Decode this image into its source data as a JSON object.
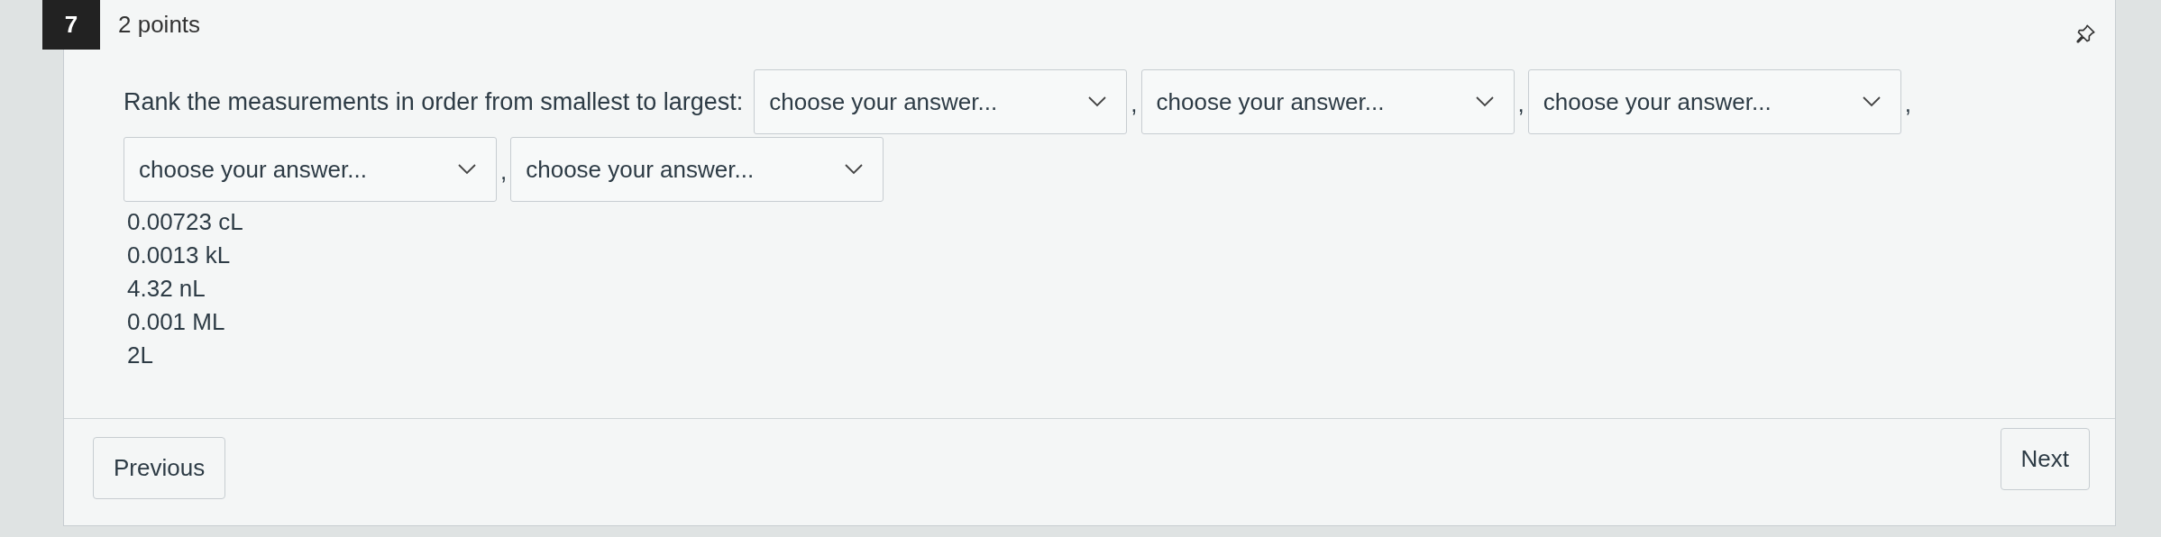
{
  "question": {
    "number": "7",
    "points": "2 points",
    "prompt": "Rank the measurements in order from smallest to largest:",
    "answers": [
      {
        "placeholder": "choose your answer...",
        "separator": ","
      },
      {
        "placeholder": "choose your answer...",
        "separator": ","
      },
      {
        "placeholder": "choose your answer...",
        "separator": ","
      },
      {
        "placeholder": "choose your answer...",
        "separator": ","
      },
      {
        "placeholder": "choose your answer..."
      }
    ],
    "items": [
      "0.00723 cL",
      "0.0013 kL",
      "4.32 nL",
      "0.001 ML",
      "2L"
    ]
  },
  "navigation": {
    "previous": "Previous",
    "next": "Next"
  }
}
